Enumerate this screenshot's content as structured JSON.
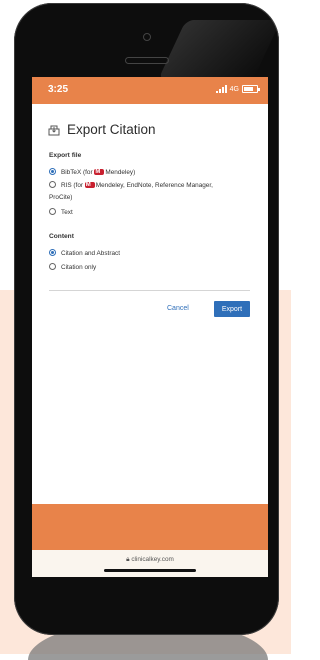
{
  "status_bar": {
    "time": "3:25",
    "network": "4G"
  },
  "dialog": {
    "title": "Export Citation",
    "export_file_heading": "Export file",
    "options_file": [
      {
        "label_pre": "BibTeX (for ",
        "label_post": "Mendeley)",
        "selected": true
      },
      {
        "label_pre": "RIS (for ",
        "label_post": "Mendeley, EndNote, Reference Manager,",
        "label_line2": "ProCite)",
        "selected": false
      },
      {
        "label": "Text",
        "selected": false
      }
    ],
    "content_heading": "Content",
    "options_content": [
      {
        "label": "Citation and Abstract",
        "selected": true
      },
      {
        "label": "Citation only",
        "selected": false
      }
    ],
    "cancel_label": "Cancel",
    "export_label": "Export"
  },
  "browser": {
    "url": "clinicalkey.com"
  },
  "colors": {
    "accent_orange": "#e8834a",
    "primary_blue": "#2f6fb9",
    "peach_bg": "#fde7da"
  }
}
